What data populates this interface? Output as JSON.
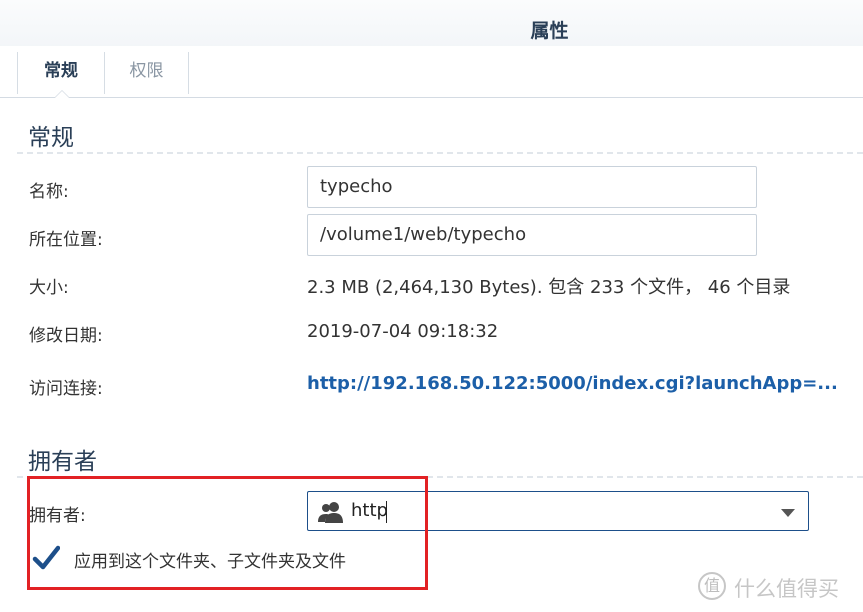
{
  "window": {
    "title": "属性"
  },
  "tabs": [
    {
      "label": "常规",
      "active": true
    },
    {
      "label": "权限",
      "active": false
    }
  ],
  "general": {
    "section_title": "常规",
    "name_label": "名称:",
    "name_value": "typecho",
    "location_label": "所在位置:",
    "location_value": "/volume1/web/typecho",
    "size_label": "大小:",
    "size_value": "2.3 MB (2,464,130 Bytes). 包含 233 个文件， 46 个目录",
    "modified_label": "修改日期:",
    "modified_value": "2019-07-04 09:18:32",
    "link_label": "访问连接:",
    "link_value": "http://192.168.50.122:5000/index.cgi?launchApp=..."
  },
  "owner": {
    "section_title": "拥有者",
    "owner_label": "拥有者:",
    "owner_value": "http",
    "owner_icon": "user-group-icon",
    "apply_label": "应用到这个文件夹、子文件夹及文件",
    "apply_checked": true
  },
  "watermark": {
    "glyph": "值",
    "text": "什么值得买"
  },
  "colors": {
    "accent": "#2a3f57",
    "link": "#1c5fa8",
    "highlight": "#e22124",
    "checkbox": "#1d4f8a"
  }
}
